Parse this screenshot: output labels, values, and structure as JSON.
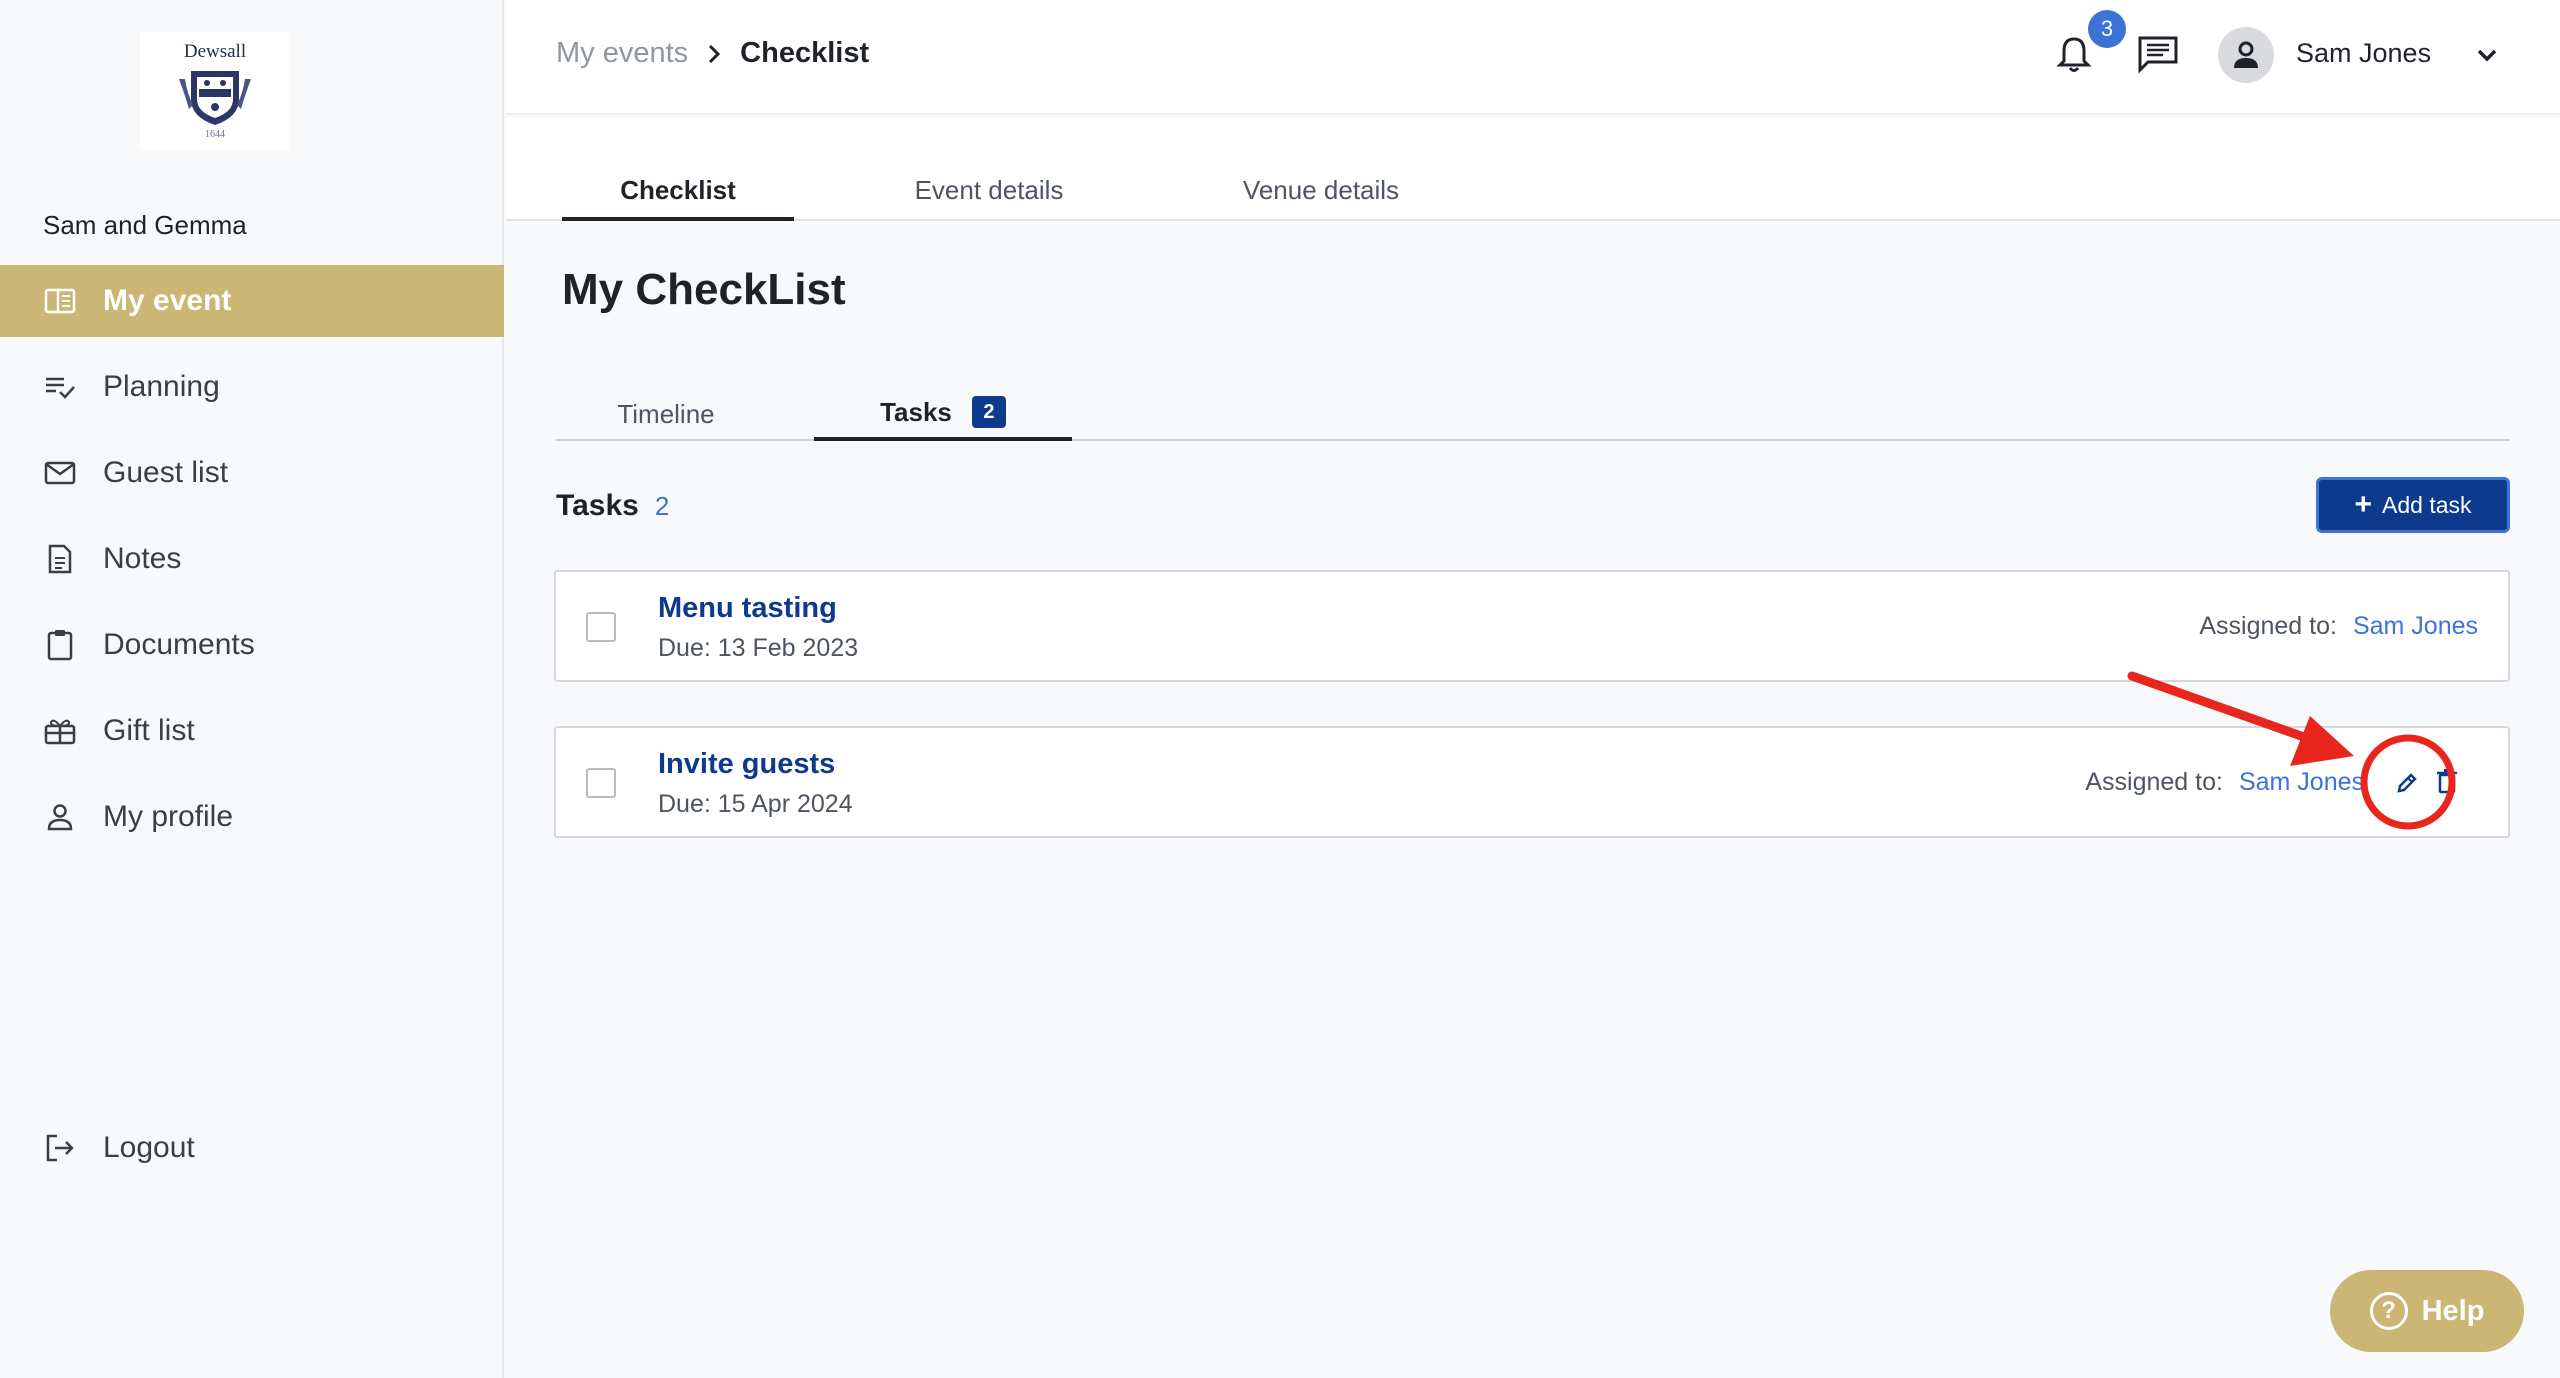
{
  "sidebar": {
    "logo_text": "Dewsall",
    "logo_year": "1644",
    "event_name": "Sam and Gemma",
    "items": [
      {
        "label": "My event",
        "icon": "book-open-icon",
        "active": true
      },
      {
        "label": "Planning",
        "icon": "list-check-icon"
      },
      {
        "label": "Guest list",
        "icon": "envelope-icon"
      },
      {
        "label": "Notes",
        "icon": "document-icon"
      },
      {
        "label": "Documents",
        "icon": "clipboard-icon"
      },
      {
        "label": "Gift list",
        "icon": "gift-icon"
      },
      {
        "label": "My profile",
        "icon": "user-icon"
      }
    ],
    "logout_label": "Logout"
  },
  "header": {
    "breadcrumb_parent": "My events",
    "breadcrumb_current": "Checklist",
    "notification_count": "3",
    "user_name": "Sam Jones"
  },
  "top_tabs": [
    {
      "label": "Checklist",
      "active": true
    },
    {
      "label": "Event details"
    },
    {
      "label": "Venue details"
    }
  ],
  "page_title": "My CheckList",
  "sub_tabs": [
    {
      "label": "Timeline"
    },
    {
      "label": "Tasks",
      "badge": "2",
      "active": true
    }
  ],
  "tasks_section": {
    "title": "Tasks",
    "count": "2",
    "add_label": "Add task"
  },
  "tasks": [
    {
      "title": "Menu tasting",
      "due": "Due: 13 Feb 2023",
      "assigned_label": "Assigned to:",
      "assignee": "Sam Jones"
    },
    {
      "title": "Invite guests",
      "due": "Due: 15 Apr 2024",
      "assigned_label": "Assigned to:",
      "assignee": "Sam Jones"
    }
  ],
  "help_label": "Help",
  "colors": {
    "accent_gold": "#cbb676",
    "primary_navy": "#0d3a8c",
    "link_blue": "#3d73d6",
    "annotation_red": "#e8261e"
  }
}
